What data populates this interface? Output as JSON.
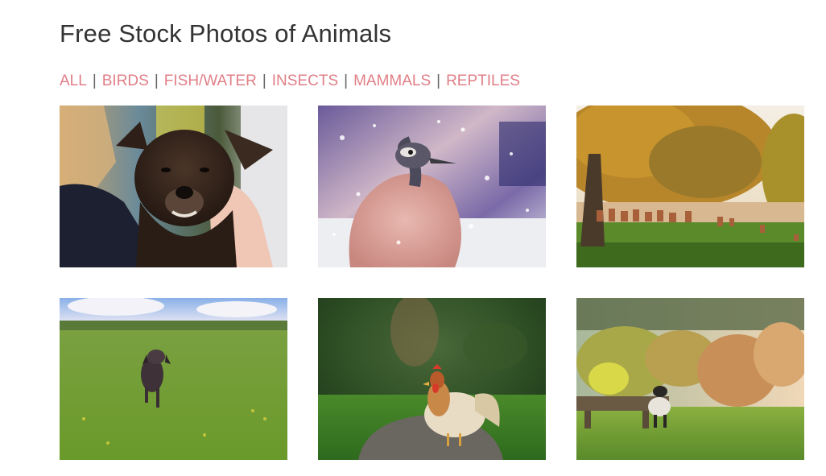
{
  "page": {
    "title": "Free Stock Photos of Animals"
  },
  "filters": [
    {
      "label": "ALL"
    },
    {
      "label": "BIRDS"
    },
    {
      "label": "FISH/WATER"
    },
    {
      "label": "INSECTS"
    },
    {
      "label": "MAMMALS"
    },
    {
      "label": "REPTILES"
    }
  ],
  "filter_separator": "|",
  "colors": {
    "accent": "#e07f87",
    "title": "#333333"
  },
  "photos": [
    {
      "subject": "puppy"
    },
    {
      "subject": "peacock-in-snow"
    },
    {
      "subject": "deer-herd-in-autumn-park"
    },
    {
      "subject": "dog-running-in-field"
    },
    {
      "subject": "rooster"
    },
    {
      "subject": "lamb-by-bench"
    }
  ]
}
